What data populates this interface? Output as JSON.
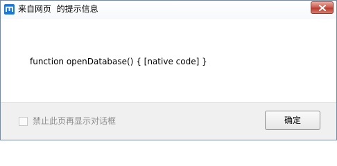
{
  "dialog": {
    "title": "来自网页  的提示信息",
    "message": "function openDatabase() { [native code] }",
    "checkbox_label": "禁止此页再显示对话框",
    "checkbox_checked": false,
    "ok_label": "确定",
    "app_icon": "maxthon-m-icon",
    "close_icon": "close-icon",
    "accent_color": "#1a78d6",
    "close_color": "#c9584b"
  }
}
